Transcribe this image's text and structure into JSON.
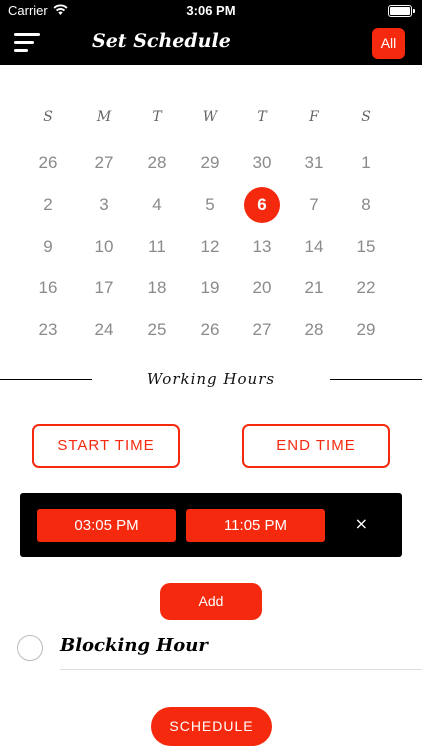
{
  "status_bar": {
    "carrier": "Carrier",
    "time": "3:06 PM"
  },
  "nav": {
    "title": "Set Schedule",
    "all_label": "All"
  },
  "calendar": {
    "weekdays": [
      "S",
      "M",
      "T",
      "W",
      "T",
      "F",
      "S"
    ],
    "weeks": [
      [
        "26",
        "27",
        "28",
        "29",
        "30",
        "31",
        "1"
      ],
      [
        "2",
        "3",
        "4",
        "5",
        "6",
        "7",
        "8"
      ],
      [
        "9",
        "10",
        "11",
        "12",
        "13",
        "14",
        "15"
      ],
      [
        "16",
        "17",
        "18",
        "19",
        "20",
        "21",
        "22"
      ],
      [
        "23",
        "24",
        "25",
        "26",
        "27",
        "28",
        "29"
      ]
    ],
    "selected_day": "6"
  },
  "working_hours": {
    "title": "Working Hours",
    "start_label": "START TIME",
    "end_label": "END TIME",
    "start_value": "03:05 PM",
    "end_value": "11:05 PM",
    "remove_label": "×"
  },
  "actions": {
    "add_label": "Add",
    "blocking_label": "Blocking Hour",
    "schedule_label": "SCHEDULE"
  },
  "colors": {
    "accent": "#f5290e",
    "bar": "#000000"
  }
}
